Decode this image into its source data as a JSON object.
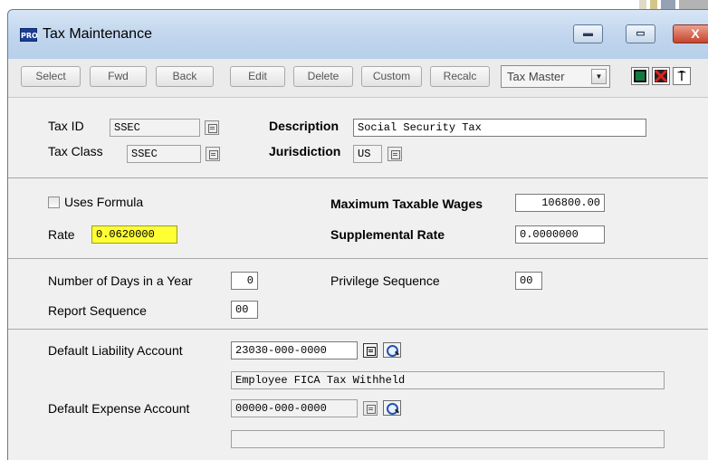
{
  "window": {
    "title": "Tax Maintenance",
    "app_icon_text": "PRO",
    "minimize": "▬",
    "maximize": "▭",
    "close": "X"
  },
  "toolbar": {
    "buttons": [
      {
        "label": "Select"
      },
      {
        "label": "Fwd"
      },
      {
        "label": "Back"
      },
      {
        "label": "Edit"
      },
      {
        "label": "Delete"
      },
      {
        "label": "Custom"
      },
      {
        "label": "Recalc"
      }
    ],
    "view_select": "Tax Master",
    "view_arrow": "▼",
    "icons": [
      "save-icon",
      "cancel-icon",
      "exit-icon"
    ],
    "exit_glyph": "⍑"
  },
  "header": {
    "tax_id_label": "Tax ID",
    "tax_id": "SSEC",
    "description_label": "Description",
    "description": "Social Security Tax",
    "tax_class_label": "Tax Class",
    "tax_class": "SSEC",
    "jurisdiction_label": "Jurisdiction",
    "jurisdiction": "US"
  },
  "rates": {
    "uses_formula_label": "Uses Formula",
    "uses_formula": false,
    "rate_label": "Rate",
    "rate": "0.0620000",
    "max_wages_label": "Maximum Taxable Wages",
    "max_wages": "106800.00",
    "supplemental_label": "Supplemental Rate",
    "supplemental": "0.0000000"
  },
  "sequence": {
    "days_label": "Number of Days in a Year",
    "days": "0",
    "privilege_label": "Privilege Sequence",
    "privilege": "00",
    "report_label": "Report Sequence",
    "report": "00"
  },
  "accounts": {
    "liability_label": "Default Liability Account",
    "liability": "23030-000-0000",
    "liability_desc": "Employee FICA Tax Withheld",
    "expense_label": "Default Expense Account",
    "expense": "00000-000-0000",
    "expense_desc": ""
  },
  "colors": {
    "highlight": "#ffff33",
    "titlebar": "#c3d7ee",
    "close": "#c5432c"
  }
}
